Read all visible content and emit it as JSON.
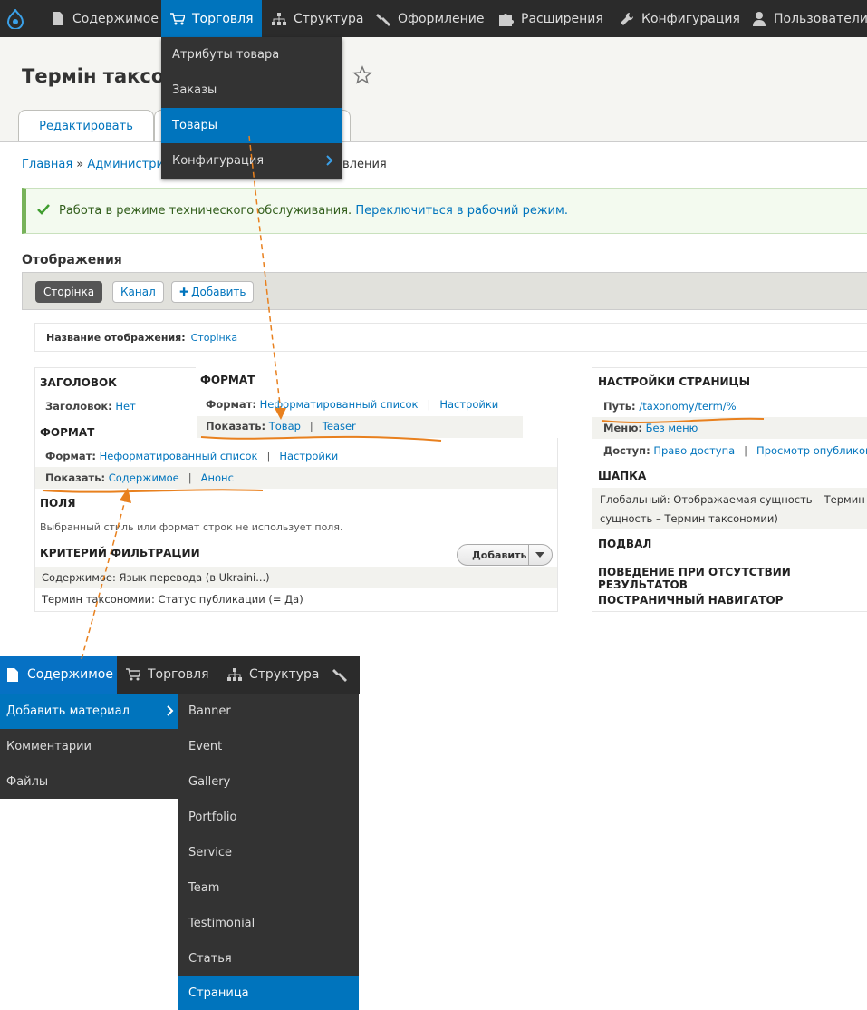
{
  "toolbar": {
    "items": [
      "Содержимое",
      "Торговля",
      "Структура",
      "Оформление",
      "Расширения",
      "Конфигурация",
      "Пользователи"
    ]
  },
  "commerce_menu": {
    "items": [
      "Атрибуты товара",
      "Заказы",
      "Товары",
      "Конфигурация"
    ]
  },
  "page": {
    "title": "Термін таксон",
    "tabs": [
      "Редактировать"
    ],
    "breadcrumb_home": "Главная",
    "breadcrumb_sep": "»",
    "breadcrumb_admin": "Администрир",
    "breadcrumb_tail": "вления"
  },
  "message": {
    "text": "Работа в режиме технического обслуживания.",
    "link": "Переключиться в рабочий режим."
  },
  "displays": {
    "title": "Отображения",
    "tabs": [
      "Сторінка",
      "Канал"
    ],
    "add": "Добавить",
    "name_label": "Название отображения:",
    "name_value": "Сторінка"
  },
  "left": {
    "header_title": "ЗАГОЛОВОК",
    "header_label": "Заголовок:",
    "header_value": "Нет",
    "format_title": "ФОРМАТ",
    "format_label": "Формат:",
    "format_value": "Неформатированный список",
    "format_settings": "Настройки",
    "show_label": "Показать:",
    "show_value": "Содержимое",
    "show_teaser": "Анонс",
    "fields_title": "ПОЛЯ",
    "fields_note": "Выбранный стиль или формат строк не использует поля.",
    "filter_title": "КРИТЕРИЙ ФИЛЬТРАЦИИ",
    "filter_add": "Добавить",
    "filter_1": "Содержимое: Язык перевода (в Ukraini...)",
    "filter_2": "Термин таксономии: Статус публикации (= Да)"
  },
  "overlay_format": {
    "title": "ФОРМАТ",
    "format_label": "Формат:",
    "format_value": "Неформатированный список",
    "format_settings": "Настройки",
    "show_label": "Показать:",
    "show_value": "Товар",
    "show_teaser": "Teaser"
  },
  "right": {
    "page_title": "НАСТРОЙКИ СТРАНИЦЫ",
    "path_label": "Путь:",
    "path_value": "/taxonomy/term/%",
    "menu_label": "Меню:",
    "menu_value": "Без меню",
    "access_label": "Доступ:",
    "access_value": "Право доступа",
    "access_more": "Просмотр опубликов",
    "header_title": "ШАПКА",
    "header_line1": "Глобальный: Отображаемая сущность – Термин т",
    "header_line2": "сущность – Термин таксономии)",
    "footer_title": "ПОДВАЛ",
    "empty_title": "ПОВЕДЕНИЕ ПРИ ОТСУТСТВИИ РЕЗУЛЬТАТОВ",
    "pager_title": "ПОСТРАНИЧНЫЙ НАВИГАТОР"
  },
  "toolbar2": {
    "items": [
      "Содержимое",
      "Торговля",
      "Структура"
    ]
  },
  "content_menu": {
    "items": [
      "Добавить материал",
      "Комментарии",
      "Файлы"
    ]
  },
  "add_content_menu": {
    "items": [
      "Banner",
      "Event",
      "Gallery",
      "Portfolio",
      "Service",
      "Team",
      "Testimonial",
      "Статья",
      "Страница"
    ]
  },
  "colors": {
    "accent": "#0074bd",
    "toolbar": "#2b2b2b",
    "annotation": "#e8801e"
  }
}
